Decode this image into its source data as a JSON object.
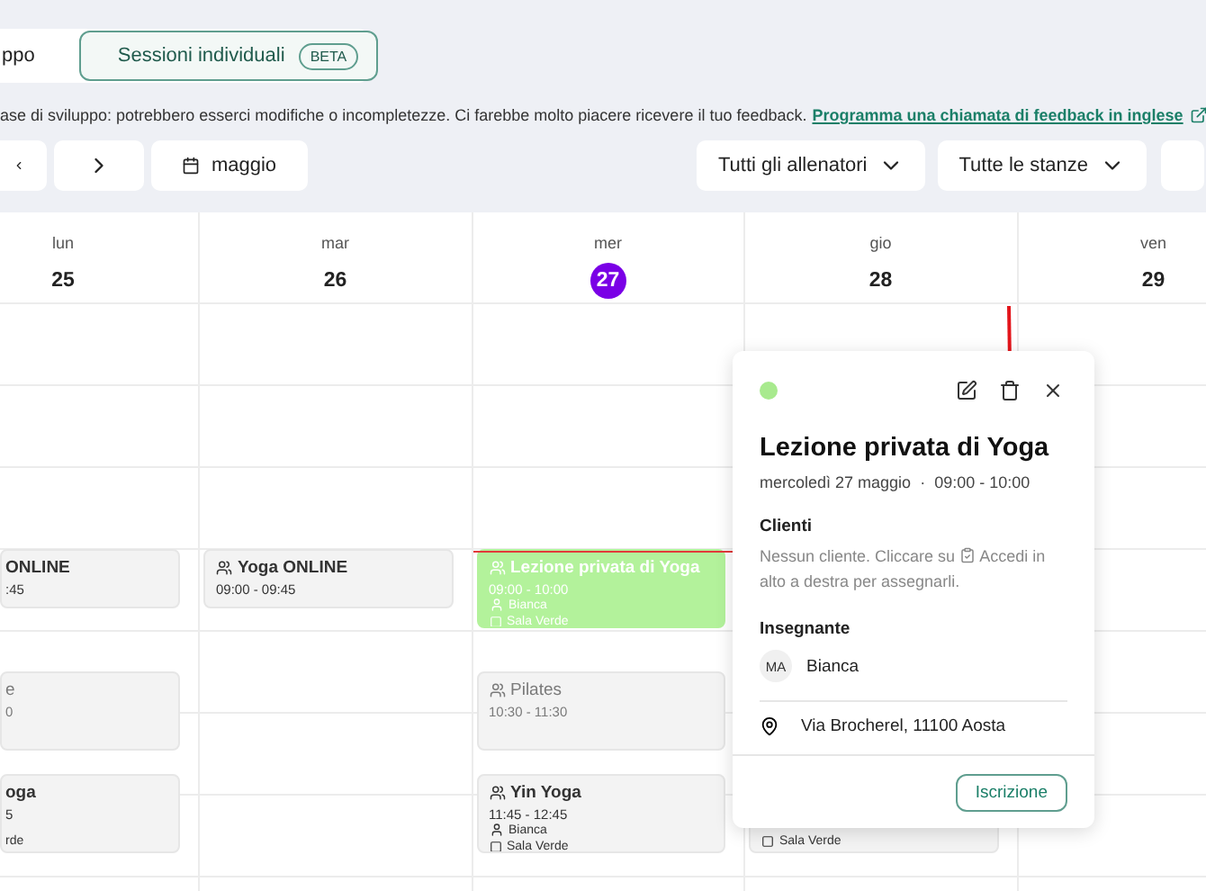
{
  "mode_tabs": [
    {
      "label": "ppo",
      "selected": false
    },
    {
      "label": "Sessioni individuali",
      "badge": "BETA",
      "selected": true
    }
  ],
  "notice": {
    "text": "ase di sviluppo: potrebbero esserci modifiche o incompletezze. Ci farebbe molto piacere ricevere il tuo feedback.",
    "link": "Programma una chiamata di feedback in inglese"
  },
  "toolbar": {
    "month": "maggio",
    "filters": [
      "Tutti gli allenatori",
      "Tutte le stanze"
    ]
  },
  "days": [
    {
      "weekday": "lun",
      "date": "25",
      "today": false,
      "events": [
        {
          "kind": "clipped",
          "title": "ONLINE",
          "time": ":45",
          "cancelled": false
        },
        {
          "kind": "clipped",
          "title": "e",
          "time": "0",
          "cancelled": true
        },
        {
          "kind": "clipped",
          "title": "oga",
          "time": "5",
          "room": "rde",
          "cancelled": false
        }
      ]
    },
    {
      "weekday": "mar",
      "date": "26",
      "today": false,
      "events": [
        {
          "kind": "group",
          "title": "Yoga ONLINE",
          "time": "09:00 - 09:45",
          "cancelled": false
        }
      ]
    },
    {
      "weekday": "mer",
      "date": "27",
      "today": true,
      "events": [
        {
          "kind": "private",
          "title": "Lezione privata di Yoga",
          "time": "09:00 - 10:00",
          "teacher": "Bianca",
          "room": "Sala Verde",
          "cancelled": false
        },
        {
          "kind": "group",
          "title": "Pilates",
          "time": "10:30 - 11:30",
          "cancelled": true
        },
        {
          "kind": "group",
          "title": "Yin Yoga",
          "time": "11:45 - 12:45",
          "teacher": "Bianca",
          "room": "Sala Verde",
          "cancelled": false
        }
      ]
    },
    {
      "weekday": "gio",
      "date": "28",
      "today": false,
      "events": [
        {
          "kind": "group",
          "room": "Sala Verde"
        }
      ]
    },
    {
      "weekday": "ven",
      "date": "29",
      "today": false
    }
  ],
  "popup": {
    "kind": "private",
    "title": "Lezione privata di Yoga",
    "date": "mercoledì 27 maggio",
    "separator": "·",
    "time": "09:00 - 10:00",
    "clients_heading": "Clienti",
    "clients_before": "Nessun cliente. Cliccare su",
    "clients_after": "Accedi in alto a destra per assegnarli.",
    "teacher_heading": "Insegnante",
    "teacher_initials": "MA",
    "teacher": "Bianca",
    "address": "Via Brocherel, 11100 Aosta",
    "action": "Iscrizione"
  }
}
